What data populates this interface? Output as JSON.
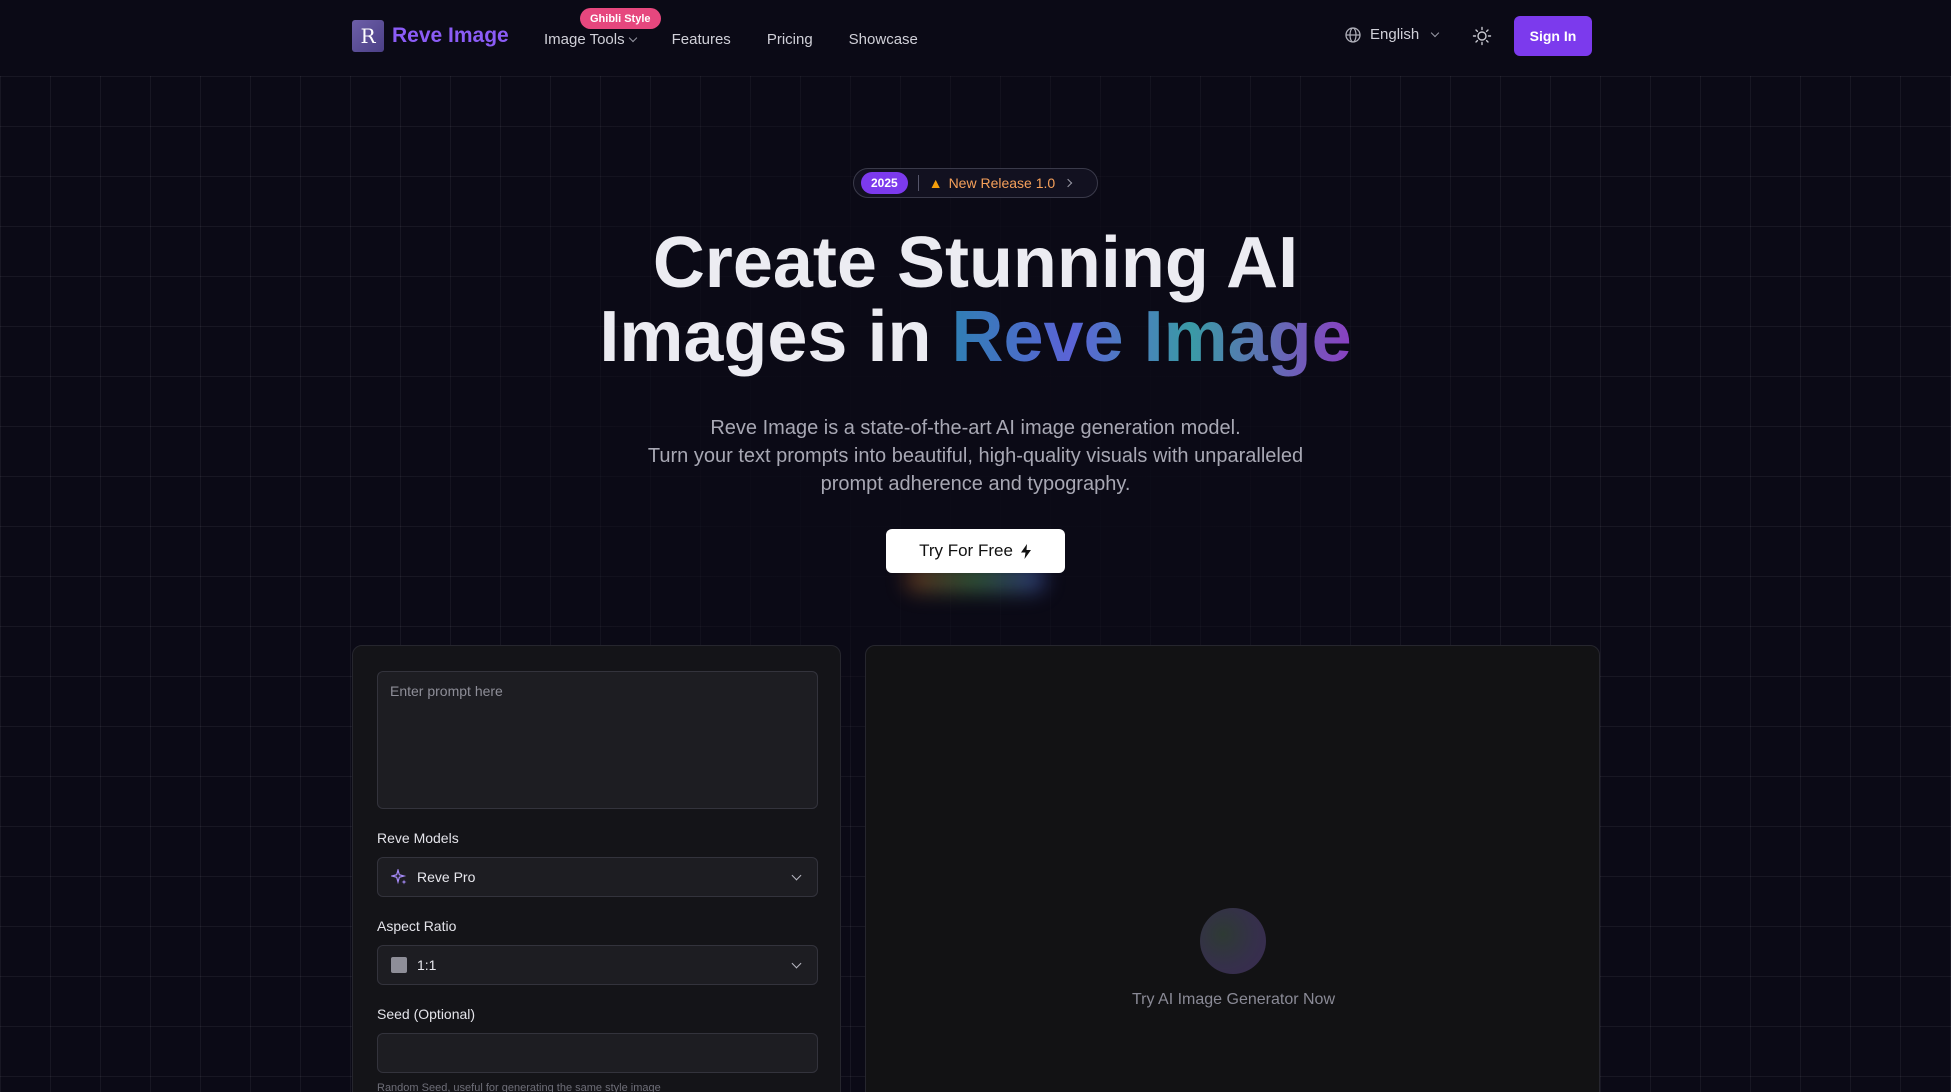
{
  "nav": {
    "logo_text": "Reve Image",
    "logo_letter": "R",
    "links": [
      {
        "label": "Image Tools"
      },
      {
        "label": "Features"
      },
      {
        "label": "Pricing"
      },
      {
        "label": "Showcase"
      }
    ],
    "badge": "Ghibli Style",
    "language": "English",
    "signin_label": "Sign In"
  },
  "hero": {
    "year_badge": "2025",
    "release_label": "New Release 1.0",
    "headline_line1": "Create Stunning AI",
    "headline_line2_prefix": "Images in ",
    "headline_line2_highlight": "Reve Image",
    "subtitle_line1": "Reve Image is a state-of-the-art AI image generation model.",
    "subtitle_line2": "Turn your text prompts into beautiful, high-quality visuals with unparalleled",
    "subtitle_line3": "prompt adherence and typography.",
    "cta_label": "Try For Free"
  },
  "generator": {
    "prompt_placeholder": "Enter prompt here",
    "models_label": "Reve Models",
    "model_value": "Reve Pro",
    "aspect_label": "Aspect Ratio",
    "aspect_value": "1:1",
    "seed_label": "Seed (Optional)",
    "seed_hint": "Random Seed, useful for generating the same style image",
    "preview_text": "Try AI Image Generator Now"
  },
  "colors": {
    "accent": "#7c3aed",
    "logo_text": "#8b5cf6",
    "badge_pink": "#e6477e",
    "background": "#0b0a16"
  },
  "icons": [
    "globe-icon",
    "chevron-down-icon",
    "sun-icon",
    "party-cone-icon",
    "chevron-right-icon",
    "lightning-icon",
    "sparkle-icon",
    "square-ratio-icon"
  ]
}
